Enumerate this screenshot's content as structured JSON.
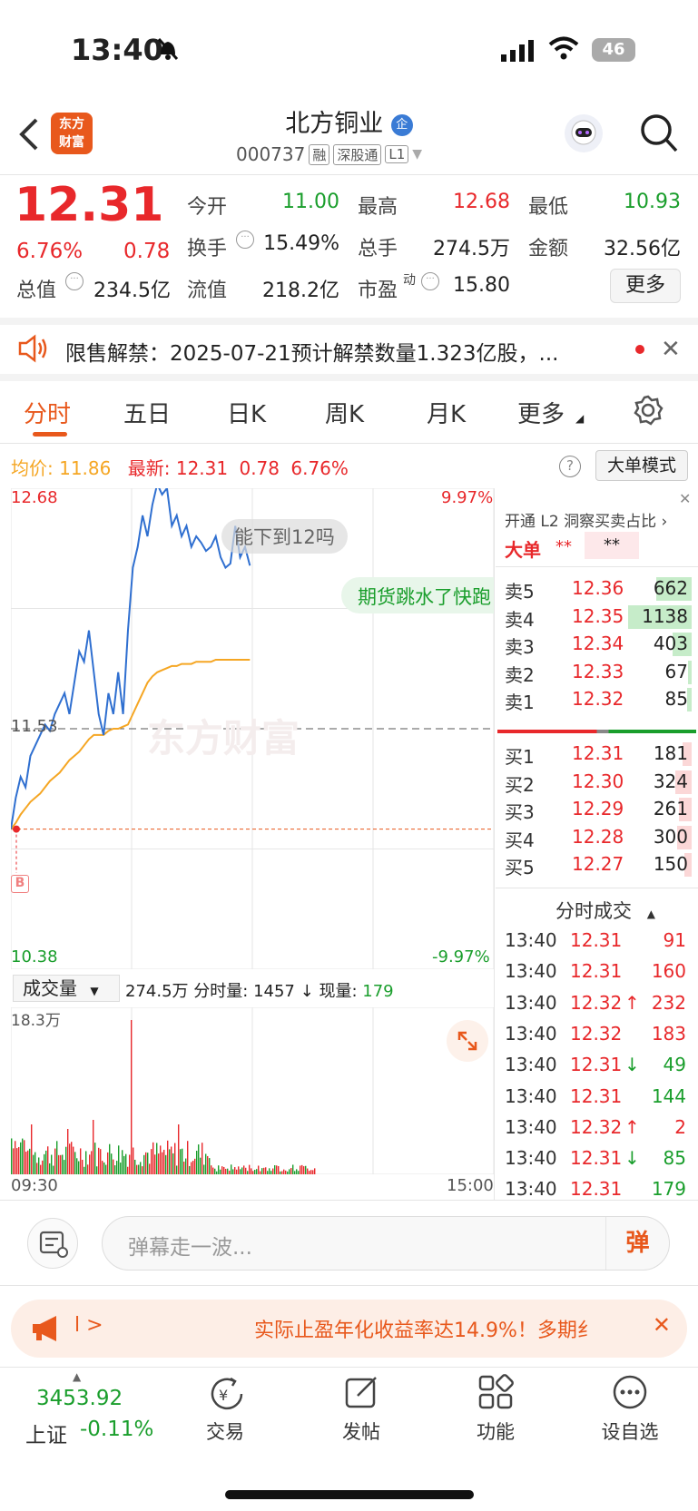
{
  "status": {
    "time": "13:40",
    "battery": "46"
  },
  "header": {
    "logo_text": "东方\n财富",
    "stock_name": "北方铜业",
    "enterprise_badge": "企",
    "code": "000737",
    "tags": [
      "融",
      "深股通",
      "L1"
    ]
  },
  "quote": {
    "price": "12.31",
    "change_pct": "6.76%",
    "change_amt": "0.78",
    "items": [
      {
        "label": "今开",
        "value": "11.00",
        "color": "green"
      },
      {
        "label": "最高",
        "value": "12.68",
        "color": "red"
      },
      {
        "label": "最低",
        "value": "10.93",
        "color": "green"
      },
      {
        "label": "换手",
        "value": "15.49%",
        "color": "dark"
      },
      {
        "label": "总手",
        "value": "274.5万",
        "color": "dark"
      },
      {
        "label": "金额",
        "value": "32.56亿",
        "color": "dark"
      },
      {
        "label": "总值",
        "value": "234.5亿",
        "color": "dark"
      },
      {
        "label": "流值",
        "value": "218.2亿",
        "color": "dark"
      },
      {
        "label": "市盈",
        "value": "15.80",
        "color": "dark"
      }
    ],
    "pe_superscript": "动",
    "more_button": "更多"
  },
  "notice": {
    "text": "限售解禁：2025-07-21预计解禁数量1.323亿股，..."
  },
  "tabs": [
    "分时",
    "五日",
    "日K",
    "周K",
    "月K",
    "更多"
  ],
  "chart_header": {
    "avg_label": "均价:",
    "avg_value": "11.86",
    "latest_label": "最新:",
    "latest_value": "12.31",
    "latest_change": "0.78",
    "latest_pct": "6.76%",
    "mode_button": "大单模式",
    "help_icon": "?"
  },
  "chart_data": {
    "type": "line",
    "price_axis": {
      "max": "12.68",
      "mid": "11.53",
      "min": "10.38",
      "max_pct": "9.97%",
      "min_pct": "-9.97%"
    },
    "series": [
      {
        "name": "price",
        "color": "#2f6fd0",
        "values": [
          11.05,
          11.2,
          11.3,
          11.25,
          11.4,
          11.45,
          11.5,
          11.55,
          11.52,
          11.6,
          11.65,
          11.7,
          11.6,
          11.75,
          11.9,
          11.85,
          12.0,
          11.8,
          11.6,
          11.5,
          11.7,
          11.6,
          11.8,
          11.6,
          12.0,
          12.3,
          12.4,
          12.55,
          12.45,
          12.6,
          12.7,
          12.65,
          12.68,
          12.5,
          12.55,
          12.45,
          12.5,
          12.4,
          12.45,
          12.42,
          12.38,
          12.4,
          12.45,
          12.35,
          12.3,
          12.32,
          12.5,
          12.35,
          12.4,
          12.31
        ]
      },
      {
        "name": "avg",
        "color": "#f5a623",
        "values": [
          11.05,
          11.08,
          11.12,
          11.15,
          11.18,
          11.2,
          11.22,
          11.25,
          11.28,
          11.3,
          11.32,
          11.35,
          11.38,
          11.4,
          11.42,
          11.45,
          11.48,
          11.5,
          11.5,
          11.5,
          11.52,
          11.53,
          11.53,
          11.54,
          11.55,
          11.6,
          11.65,
          11.7,
          11.75,
          11.78,
          11.8,
          11.81,
          11.82,
          11.83,
          11.83,
          11.84,
          11.84,
          11.84,
          11.85,
          11.85,
          11.85,
          11.85,
          11.86,
          11.86,
          11.86,
          11.86,
          11.86,
          11.86,
          11.86,
          11.86
        ]
      }
    ],
    "buy_marker": "B",
    "watermark": "东方财富"
  },
  "bubbles": [
    "能下到12吗",
    "期货跳水了快跑"
  ],
  "volume": {
    "selector": "成交量",
    "total": "274.5万",
    "period_label": "分时量:",
    "period_value": "1457",
    "current_label": "现量:",
    "current_value": "179",
    "max_label": "18.3万",
    "start_time": "09:30",
    "end_time": "15:00"
  },
  "orderbook": {
    "title": "开通 L2 洞察买卖占比",
    "big_order_label": "大单",
    "big_order_v1": "**",
    "big_order_v2": "**",
    "sells": [
      {
        "label": "卖5",
        "price": "12.36",
        "vol": "662",
        "ratio": 0.56
      },
      {
        "label": "卖4",
        "price": "12.35",
        "vol": "1138",
        "ratio": 1.0
      },
      {
        "label": "卖3",
        "price": "12.34",
        "vol": "403",
        "ratio": 0.3
      },
      {
        "label": "卖2",
        "price": "12.33",
        "vol": "67",
        "ratio": 0.06
      },
      {
        "label": "卖1",
        "price": "12.32",
        "vol": "85",
        "ratio": 0.07
      }
    ],
    "buys": [
      {
        "label": "买1",
        "price": "12.31",
        "vol": "181",
        "ratio": 0.14
      },
      {
        "label": "买2",
        "price": "12.30",
        "vol": "324",
        "ratio": 0.25
      },
      {
        "label": "买3",
        "price": "12.29",
        "vol": "261",
        "ratio": 0.2
      },
      {
        "label": "买4",
        "price": "12.28",
        "vol": "300",
        "ratio": 0.23
      },
      {
        "label": "买5",
        "price": "12.27",
        "vol": "150",
        "ratio": 0.12
      }
    ]
  },
  "ticks": {
    "title": "分时成交",
    "rows": [
      {
        "time": "13:40",
        "price": "12.31",
        "arrow": "",
        "vol": "91",
        "vol_color": "red"
      },
      {
        "time": "13:40",
        "price": "12.31",
        "arrow": "",
        "vol": "160",
        "vol_color": "red"
      },
      {
        "time": "13:40",
        "price": "12.32",
        "arrow": "↑",
        "vol": "232",
        "vol_color": "red"
      },
      {
        "time": "13:40",
        "price": "12.32",
        "arrow": "",
        "vol": "183",
        "vol_color": "red"
      },
      {
        "time": "13:40",
        "price": "12.31",
        "arrow": "↓",
        "vol": "49",
        "vol_color": "green"
      },
      {
        "time": "13:40",
        "price": "12.31",
        "arrow": "",
        "vol": "144",
        "vol_color": "green"
      },
      {
        "time": "13:40",
        "price": "12.32",
        "arrow": "↑",
        "vol": "2",
        "vol_color": "red"
      },
      {
        "time": "13:40",
        "price": "12.31",
        "arrow": "↓",
        "vol": "85",
        "vol_color": "green"
      },
      {
        "time": "13:40",
        "price": "12.31",
        "arrow": "",
        "vol": "179",
        "vol_color": "green"
      }
    ]
  },
  "comment": {
    "placeholder": "弹幕走一波...",
    "send_icon": "弹"
  },
  "ad": {
    "prefix": "l >",
    "text": "实际止盈年化收益率达14.9%！多期纟"
  },
  "bottom_nav": {
    "index_value": "3453.92",
    "index_name": "上证",
    "index_change": "-0.11%",
    "items": [
      "交易",
      "发帖",
      "功能",
      "设自选"
    ]
  }
}
